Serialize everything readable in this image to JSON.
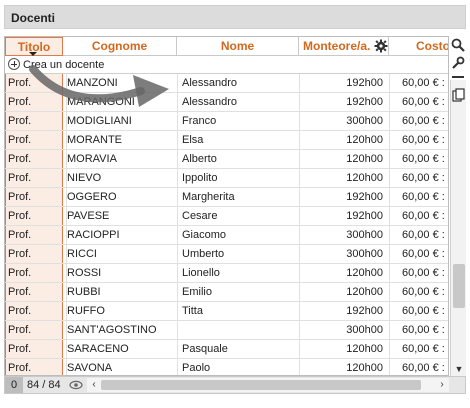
{
  "panel": {
    "title": "Docenti"
  },
  "columns": {
    "titolo": "Titolo",
    "cognome": "Cognome",
    "nome": "Nome",
    "monteore": "Monteore/a.",
    "costo": "Costo"
  },
  "create_label": "Crea un docente",
  "rows": [
    {
      "titolo": "Prof.",
      "cognome": "MANZONI",
      "nome": "Alessandro",
      "ore": "192h00",
      "costo": "60,00 € :"
    },
    {
      "titolo": "Prof.",
      "cognome": "MARANGONI",
      "nome": "Alessandro",
      "ore": "192h00",
      "costo": "60,00 € :"
    },
    {
      "titolo": "Prof.",
      "cognome": "MODIGLIANI",
      "nome": "Franco",
      "ore": "300h00",
      "costo": "60,00 € :"
    },
    {
      "titolo": "Prof.",
      "cognome": "MORANTE",
      "nome": "Elsa",
      "ore": "120h00",
      "costo": "60,00 € :"
    },
    {
      "titolo": "Prof.",
      "cognome": "MORAVIA",
      "nome": "Alberto",
      "ore": "120h00",
      "costo": "60,00 € :"
    },
    {
      "titolo": "Prof.",
      "cognome": "NIEVO",
      "nome": "Ippolito",
      "ore": "120h00",
      "costo": "60,00 € :"
    },
    {
      "titolo": "Prof.",
      "cognome": "OGGERO",
      "nome": "Margherita",
      "ore": "192h00",
      "costo": "60,00 € :"
    },
    {
      "titolo": "Prof.",
      "cognome": "PAVESE",
      "nome": "Cesare",
      "ore": "192h00",
      "costo": "60,00 € :"
    },
    {
      "titolo": "Prof.",
      "cognome": "RACIOPPI",
      "nome": "Giacomo",
      "ore": "300h00",
      "costo": "60,00 € :"
    },
    {
      "titolo": "Prof.",
      "cognome": "RICCI",
      "nome": "Umberto",
      "ore": "300h00",
      "costo": "60,00 € :"
    },
    {
      "titolo": "Prof.",
      "cognome": "ROSSI",
      "nome": "Lionello",
      "ore": "120h00",
      "costo": "60,00 € :"
    },
    {
      "titolo": "Prof.",
      "cognome": "RUBBI",
      "nome": "Emilio",
      "ore": "120h00",
      "costo": "60,00 € :"
    },
    {
      "titolo": "Prof.",
      "cognome": "RUFFO",
      "nome": "Titta",
      "ore": "192h00",
      "costo": "60,00 € :"
    },
    {
      "titolo": "Prof.",
      "cognome": "SANT'AGOSTINO",
      "nome": "",
      "ore": "300h00",
      "costo": "60,00 € :"
    },
    {
      "titolo": "Prof.",
      "cognome": "SARACENO",
      "nome": "Pasquale",
      "ore": "120h00",
      "costo": "60,00 € :"
    },
    {
      "titolo": "Prof.",
      "cognome": "SAVONA",
      "nome": "Paolo",
      "ore": "120h00",
      "costo": "60,00 € :"
    }
  ],
  "footer": {
    "selected": "0",
    "count": "84 / 84"
  },
  "colors": {
    "accent": "#d2691e",
    "selected_col_bg": "#fbece4",
    "selected_col_border": "#e07a4a"
  },
  "icons": [
    "gear-icon",
    "search-icon",
    "wrench-icon",
    "list-icon",
    "copy-icon",
    "plus-circle-icon",
    "eye-icon"
  ]
}
